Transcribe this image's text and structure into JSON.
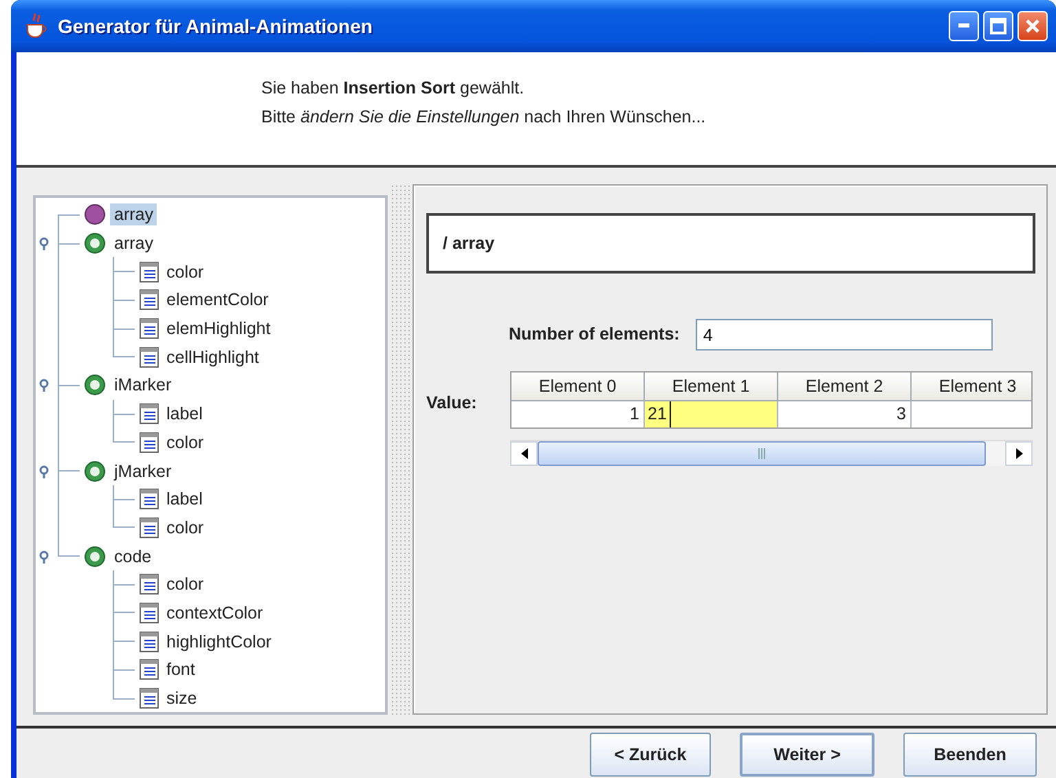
{
  "window": {
    "title": "Generator für Animal-Animationen"
  },
  "header": {
    "lines": [
      "Sie haben **Insertion Sort** gewählt.",
      "Bitte *ändern Sie die Einstellungen* nach Ihren Wünschen..."
    ]
  },
  "tree": [
    {
      "label": "array",
      "kind": "primitive",
      "selected": true
    },
    {
      "label": "array",
      "kind": "group",
      "selected": false,
      "expanded": true,
      "children": [
        {
          "label": "color",
          "selected": false
        },
        {
          "label": "elementColor",
          "selected": false
        },
        {
          "label": "elemHighlight",
          "selected": false
        },
        {
          "label": "cellHighlight",
          "selected": false
        }
      ]
    },
    {
      "label": "iMarker",
      "kind": "group",
      "selected": false,
      "expanded": true,
      "children": [
        {
          "label": "label",
          "selected": false
        },
        {
          "label": "color",
          "selected": false
        }
      ]
    },
    {
      "label": "jMarker",
      "kind": "group",
      "selected": false,
      "expanded": true,
      "children": [
        {
          "label": "label",
          "selected": false
        },
        {
          "label": "color",
          "selected": false
        }
      ]
    },
    {
      "label": "code",
      "kind": "group",
      "selected": false,
      "expanded": true,
      "children": [
        {
          "label": "color",
          "selected": false
        },
        {
          "label": "contextColor",
          "selected": false
        },
        {
          "label": "highlightColor",
          "selected": false
        },
        {
          "label": "font",
          "selected": false
        },
        {
          "label": "size",
          "selected": false
        }
      ]
    }
  ],
  "editor": {
    "path": "/ array",
    "count_label": "Number of elements:",
    "count_value": "4",
    "value_label": "Value:",
    "columns": [
      "Element 0",
      "Element 1",
      "Element 2",
      "Element 3"
    ],
    "cells": [
      {
        "value": "1",
        "editing": false
      },
      {
        "value": "21",
        "editing": true
      },
      {
        "value": "3",
        "editing": false
      },
      {
        "editing": false
      }
    ]
  },
  "buttons": [
    {
      "label": "< Zurück",
      "focused": false
    },
    {
      "label": "Weiter >",
      "focused": true
    },
    {
      "label": "Beenden",
      "focused": false
    }
  ]
}
